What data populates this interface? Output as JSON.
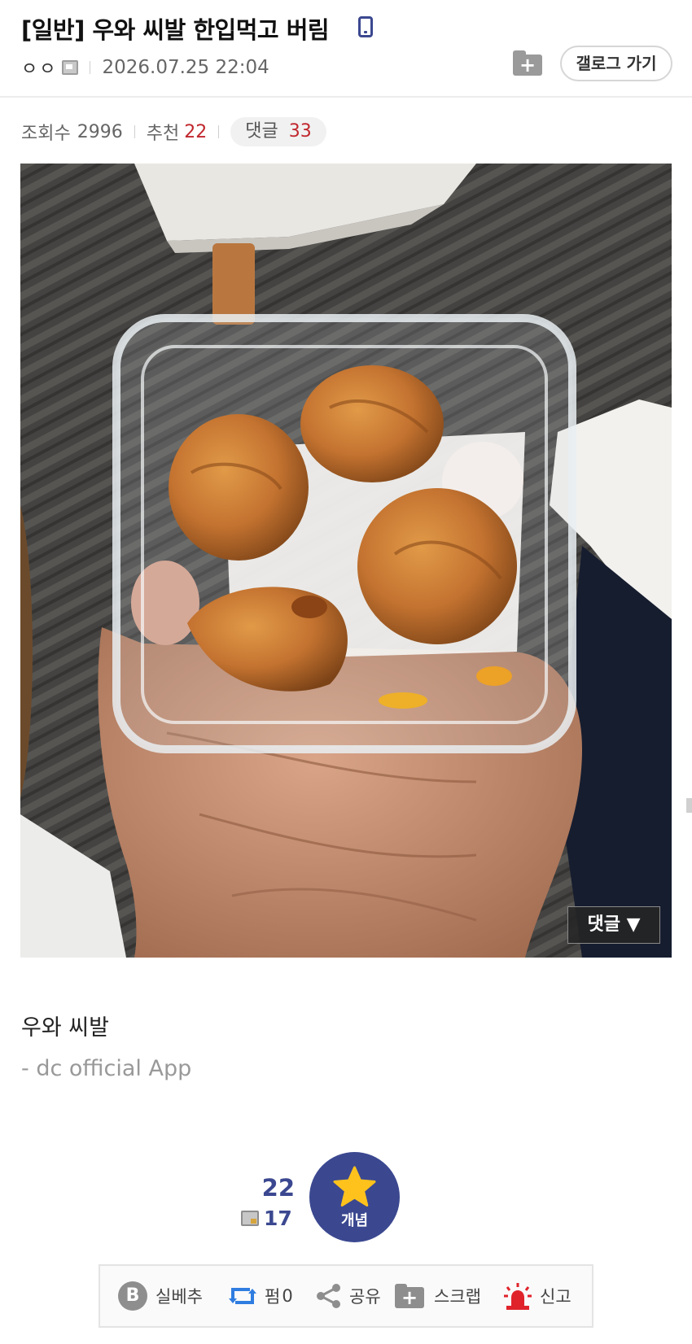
{
  "post": {
    "title": "[일반] 우와 씨발 한입먹고 버림",
    "author": "ㅇㅇ",
    "date": "2026.07.25 22:04",
    "gallery_button": "갤로그 가기",
    "folder_button": "+"
  },
  "stats": {
    "views_label": "조회수",
    "views": "2996",
    "recommend_label": "추천",
    "recommend": "22",
    "comments_label": "댓글",
    "comments": "33"
  },
  "photo": {
    "comment_button": "댓글 ▼"
  },
  "content": {
    "body": "우와 씨발",
    "signature": "- dc official App"
  },
  "recommend_box": {
    "count": "22",
    "fixed_count": "17",
    "button_label": "개념"
  },
  "actions": {
    "best_icon": "B",
    "best_label": "실베추",
    "share_count_label": "펌",
    "share_count": "0",
    "share_label": "공유",
    "scrap_icon": "+",
    "scrap_label": "스크랩",
    "report_label": "신고"
  },
  "colors": {
    "accent": "#3b4890",
    "red": "#c0272d",
    "star": "#ffc21c",
    "retweet_blue": "#2f7de1",
    "report_red": "#e0232b"
  },
  "icons": {
    "device": "mobile-phone-icon",
    "fluid": "fluid-nick-icon",
    "folder": "folder-plus-icon",
    "star": "star-icon",
    "retweet": "retweet-icon",
    "share": "share-icon",
    "siren": "siren-icon"
  }
}
